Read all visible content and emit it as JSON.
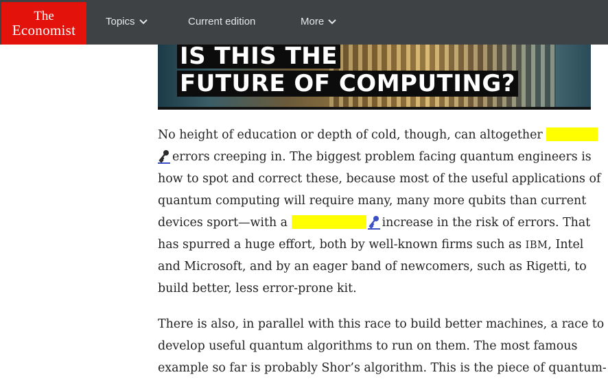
{
  "brand": {
    "line1": "The",
    "line2": "Economist"
  },
  "nav": {
    "topics": "Topics",
    "current_edition": "Current edition",
    "more": "More"
  },
  "hero": {
    "line1": "IS THIS THE",
    "line2": "FUTURE OF COMPUTING?"
  },
  "article": {
    "p1": {
      "l1": "No height of education or depth of cold, though, can altogether",
      "l2": "errors creeping in. The biggest problem facing quantum engineers is",
      "l3": "how to spot and correct these, because most of the useful applications of",
      "l4": "quantum computing will require many, many more qubits than current",
      "l5a": "devices sport—with a",
      "l5b": "increase in the risk of errors. That",
      "l6a": "has spurred a huge effort, both by well-known firms such as",
      "l6b": "IBM",
      "l6c": ", Intel",
      "l7": "and Microsoft, and by an eager band of newcomers, such as Rigetti, to",
      "l8": "build better, less error-prone kit."
    },
    "p2": {
      "l1": "There is also, in parallel with this race to build better machines, a race to",
      "l2": "develop useful quantum algorithms to run on them. The most famous",
      "l3": "example so far is probably Shor’s algorithm. This is the piece of quantum-"
    }
  },
  "colors": {
    "highlight": "#ffff00",
    "brand_red": "#e3120b",
    "nav_bg": "#3e4245",
    "key_link": "#3b4fc4"
  },
  "icons": [
    "chevron-down-icon",
    "key-icon"
  ]
}
